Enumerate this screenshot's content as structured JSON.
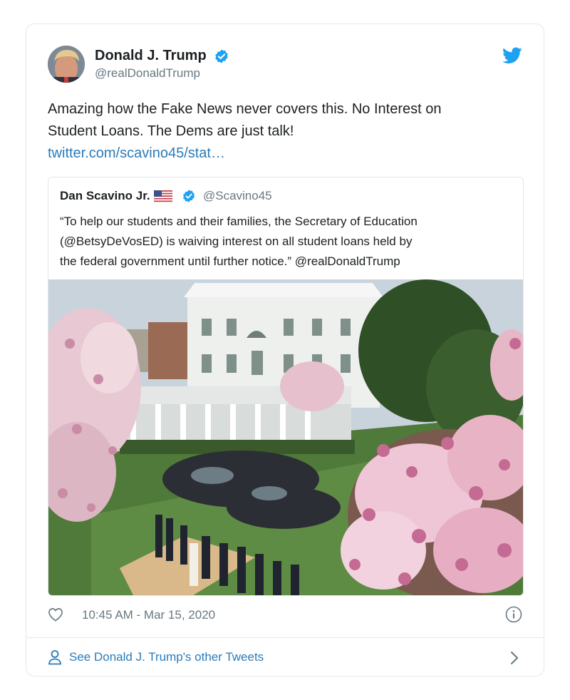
{
  "tweet": {
    "author": {
      "display_name": "Donald J. Trump",
      "handle": "@realDonaldTrump",
      "verified_icon": "verified-badge-icon",
      "avatar": "profile-photo"
    },
    "logo_icon": "twitter-bird-icon",
    "text_lines": [
      "Amazing how the Fake News never covers this. No Interest on",
      "Student Loans. The Dems are just talk!"
    ],
    "link_text": "twitter.com/scavino45/stat…",
    "quoted_tweet": {
      "display_name": "Dan Scavino Jr.",
      "flag_icon": "us-flag-icon",
      "handle": "@Scavino45",
      "text_lines": [
        "“To help our students and their families, the Secretary of Education",
        "(@BetsyDeVosED) is waiving interest on all student loans held by",
        "the federal government until further notice.” @realDonaldTrump"
      ],
      "photo": "rose-garden-press-event-photo"
    },
    "timestamp": "10:45 AM - Mar 15, 2020",
    "like_icon": "heart-icon",
    "info_icon": "info-icon",
    "footer": {
      "label": "See Donald J. Trump's other Tweets",
      "person_icon": "person-icon",
      "chevron_icon": "chevron-right-icon"
    }
  },
  "colors": {
    "link_blue": "#2b7bb9",
    "twitter_blue": "#1da1f2",
    "secondary_text": "#697882",
    "border": "#e1e8ed"
  }
}
